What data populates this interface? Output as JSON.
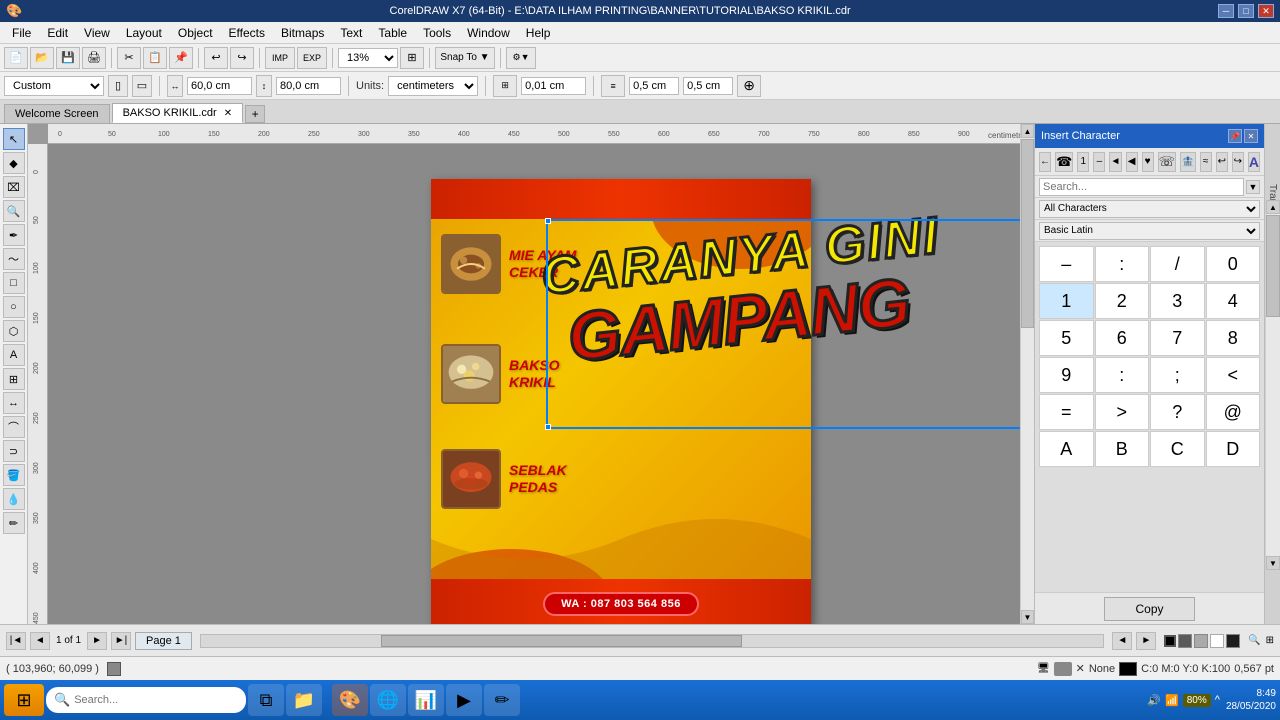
{
  "titleBar": {
    "title": "CorelDRAW X7 (64-Bit) - E:\\DATA ILHAM PRINTING\\BANNER\\TUTORIAL\\BAKSO KRIKIL.cdr",
    "minimize": "─",
    "maximize": "□",
    "close": "✕"
  },
  "menuBar": {
    "items": [
      "File",
      "Edit",
      "View",
      "Layout",
      "Object",
      "Effects",
      "Bitmaps",
      "Text",
      "Table",
      "Tools",
      "Window",
      "Help"
    ]
  },
  "toolbar": {
    "zoom": "13%",
    "snapTo": "Snap To",
    "units": "centimeters",
    "width": "60,0 cm",
    "height": "80,0 cm",
    "offsetX": "0,01 cm",
    "offsetY": "0,5 cm",
    "sizePreset": "Custom"
  },
  "tabs": {
    "items": [
      "Welcome Screen",
      "BAKSO KRIKIL.cdr"
    ],
    "active": 1
  },
  "banner": {
    "title1": "MIE AYAM",
    "title2": "CEKER",
    "title3": "BAKSO",
    "title4": "KRIKIL",
    "title5": "SEBLAK",
    "title6": "PEDAS",
    "contact": "WA : 087 803 564 856"
  },
  "overlay": {
    "line1": "CARANYA GINI",
    "line2": "GAMPANG"
  },
  "insertChar": {
    "title": "Insert Character",
    "characters": [
      "←",
      "☎",
      "1",
      "–",
      "◄",
      "◀",
      "♥",
      "☎",
      "🏦",
      "≈",
      "↩",
      "↪",
      "–",
      ":",
      "/",
      "0",
      "1",
      "2",
      "3",
      "4",
      "5",
      "6",
      "7",
      "8",
      "9",
      ":",
      ";",
      "<",
      "=",
      ">",
      "?",
      "@",
      "A",
      "B",
      "C",
      "D"
    ],
    "copyLabel": "Copy",
    "searchPlaceholder": "Search..."
  },
  "statusBar": {
    "coords": "( 103,960; 60,099 )",
    "color": "C:0 M:0 Y:0 K:100",
    "weight": "0,567 pt",
    "pageInfo": "None",
    "pageCount": "1 of 1",
    "pageName": "Page 1"
  },
  "taskbar": {
    "time": "8:49",
    "date": "28/05/2020",
    "startIcon": "⊞",
    "batteryPercent": "80%",
    "apps": [
      {
        "name": "search",
        "icon": "🔍"
      },
      {
        "name": "task-view",
        "icon": "⧉"
      },
      {
        "name": "file-explorer",
        "icon": "📁"
      },
      {
        "name": "coreldraw",
        "icon": "🎨"
      },
      {
        "name": "browser",
        "icon": "🌐"
      },
      {
        "name": "excel",
        "icon": "📊"
      },
      {
        "name": "media",
        "icon": "▶"
      },
      {
        "name": "corel-app",
        "icon": "✏"
      }
    ]
  },
  "palette": {
    "colors": [
      "#000000",
      "#4a4a4a",
      "#888888",
      "#c0c0c0",
      "#ffffff",
      "#cc0000",
      "#ee6600",
      "#f5c500",
      "#00aa00",
      "#0055cc",
      "#8800aa"
    ]
  }
}
